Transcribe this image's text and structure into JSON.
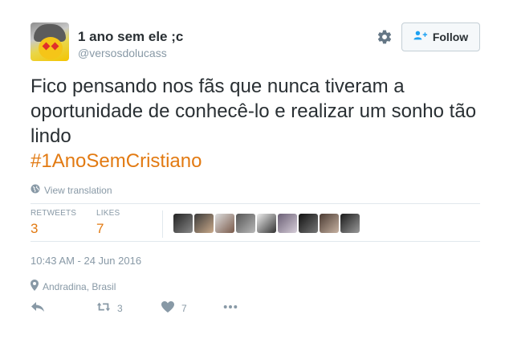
{
  "user": {
    "display_name": "1 ano sem ele ;c",
    "handle": "@versosdolucass"
  },
  "follow_button": {
    "label": "Follow"
  },
  "tweet": {
    "text": "Fico pensando nos fãs que nunca tiveram a oportunidade de conhecê-lo e realizar um sonho tão lindo",
    "hashtag": "#1AnoSemCristiano"
  },
  "translate_link": "View translation",
  "stats": {
    "retweets_label": "RETWEETS",
    "retweets_count": "3",
    "likes_label": "LIKES",
    "likes_count": "7"
  },
  "timestamp": "10:43 AM - 24 Jun 2016",
  "location": "Andradina, Brasil",
  "actions": {
    "retweet_count": "3",
    "like_count": "7"
  },
  "colors": {
    "hashtag": "#e27a12",
    "muted": "#8899a6",
    "text": "#292f33"
  },
  "icons": [
    "gear-icon",
    "follow-user-icon",
    "globe-icon",
    "location-pin-icon",
    "reply-icon",
    "retweet-icon",
    "heart-icon",
    "more-icon"
  ]
}
